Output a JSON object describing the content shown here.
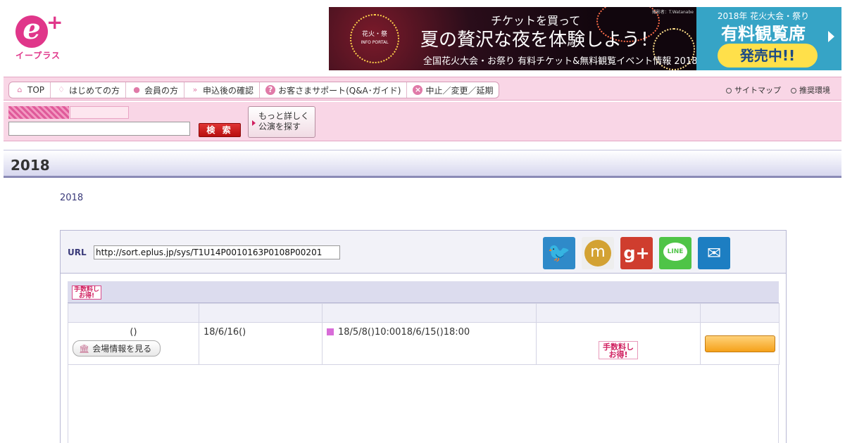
{
  "logo": {
    "kana": "イープラス"
  },
  "banner": {
    "festival_label": "花火・祭",
    "festival_sub": "INFO PORTAL",
    "line1": "チケットを買って",
    "line2": "夏の贅沢な夜を体験しよう！",
    "line3": "全国花火大会・お祭り 有料チケット&無料観覧イベント情報 2018",
    "credit": "撮影者：T.Watanabe",
    "right_line1": "2018年 花火大会・祭り",
    "right_line2": "有料観覧席",
    "right_button": "発売中!!"
  },
  "nav": {
    "items": [
      {
        "label": "TOP",
        "icon": "home-icon"
      },
      {
        "label": "はじめての方",
        "icon": "beginner-leaf-icon"
      },
      {
        "label": "会員の方",
        "icon": "person-icon"
      },
      {
        "label": "申込後の確認",
        "icon": "double-arrow-icon"
      },
      {
        "label": "お客さまサポート(Q&A･ガイド)",
        "icon": "help-icon"
      },
      {
        "label": "中止／変更／延期",
        "icon": "cancel-icon"
      }
    ],
    "sitemap": "サイトマップ",
    "environment": "推奨環境"
  },
  "search": {
    "input_value": "",
    "button_label": "検 索",
    "advanced_line1": "もっと詳しく",
    "advanced_line2": "公演を探す"
  },
  "page": {
    "title": "2018",
    "subtitle": "2018"
  },
  "share": {
    "url_label": "URL",
    "url_value": "http://sort.eplus.jp/sys/T1U14P0010163P0108P00201"
  },
  "ticket": {
    "badge_small": "手数料しお得!",
    "row": {
      "venue": "()",
      "venue_button": "会場情報を見る",
      "date": "18/6/16()",
      "period": "18/5/8()10:0018/6/15()18:00",
      "badge": "手数料しお得!"
    }
  },
  "colors": {
    "brand_pink": "#e0368a",
    "nav_bg": "#f9d6e6",
    "title_border": "#8a8ab6",
    "search_red": "#c81818",
    "order_orange": "#f5a11a"
  }
}
